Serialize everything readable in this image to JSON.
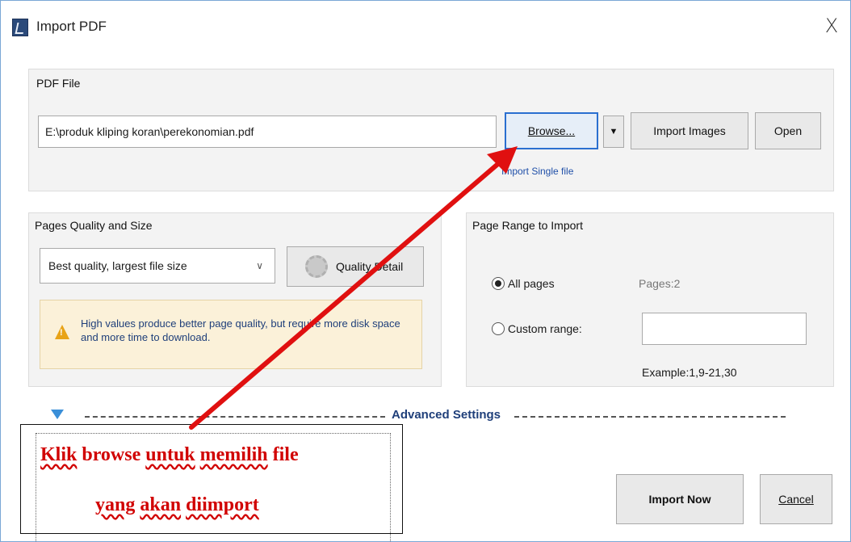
{
  "window": {
    "title": "Import PDF",
    "close_glyph": "X",
    "icon": "pdf-app-icon"
  },
  "pdf_file": {
    "group_title": "PDF File",
    "path_value": "E:\\produk kliping koran\\perekonomian.pdf",
    "browse_label": "Browse...",
    "dropdown_glyph": "▼",
    "import_images_label": "Import Images",
    "open_label": "Open",
    "single_file_hint": "Import Single file"
  },
  "quality": {
    "group_title": "Pages Quality and Size",
    "selected_option": "Best quality, largest file size",
    "detail_label": "Quality Detail",
    "warning_text": "High values produce better page quality, but require more disk space and more time to download."
  },
  "page_range": {
    "group_title": "Page Range to Import",
    "all_pages_label": "All pages",
    "pages_count": "Pages:2",
    "custom_range_label": "Custom range:",
    "custom_range_value": "",
    "example": "Example:1,9-21,30",
    "selected": "all"
  },
  "advanced": {
    "label": "Advanced Settings"
  },
  "actions": {
    "import_now_label": "Import Now",
    "cancel_label": "Cancel"
  },
  "annotation": {
    "line1_part1": "Klik",
    "line1_part2": "browse",
    "line1_part3": "untuk",
    "line1_part4": "memilih",
    "line1_part5": "file",
    "line2_part1": "yang",
    "line2_part2": "akan",
    "line2_part3": "diimport",
    "color": "#d10000"
  },
  "colors": {
    "accent_blue": "#2a6fd0",
    "warning_bg": "#fbf1d9",
    "annotation_red": "#e01010"
  }
}
